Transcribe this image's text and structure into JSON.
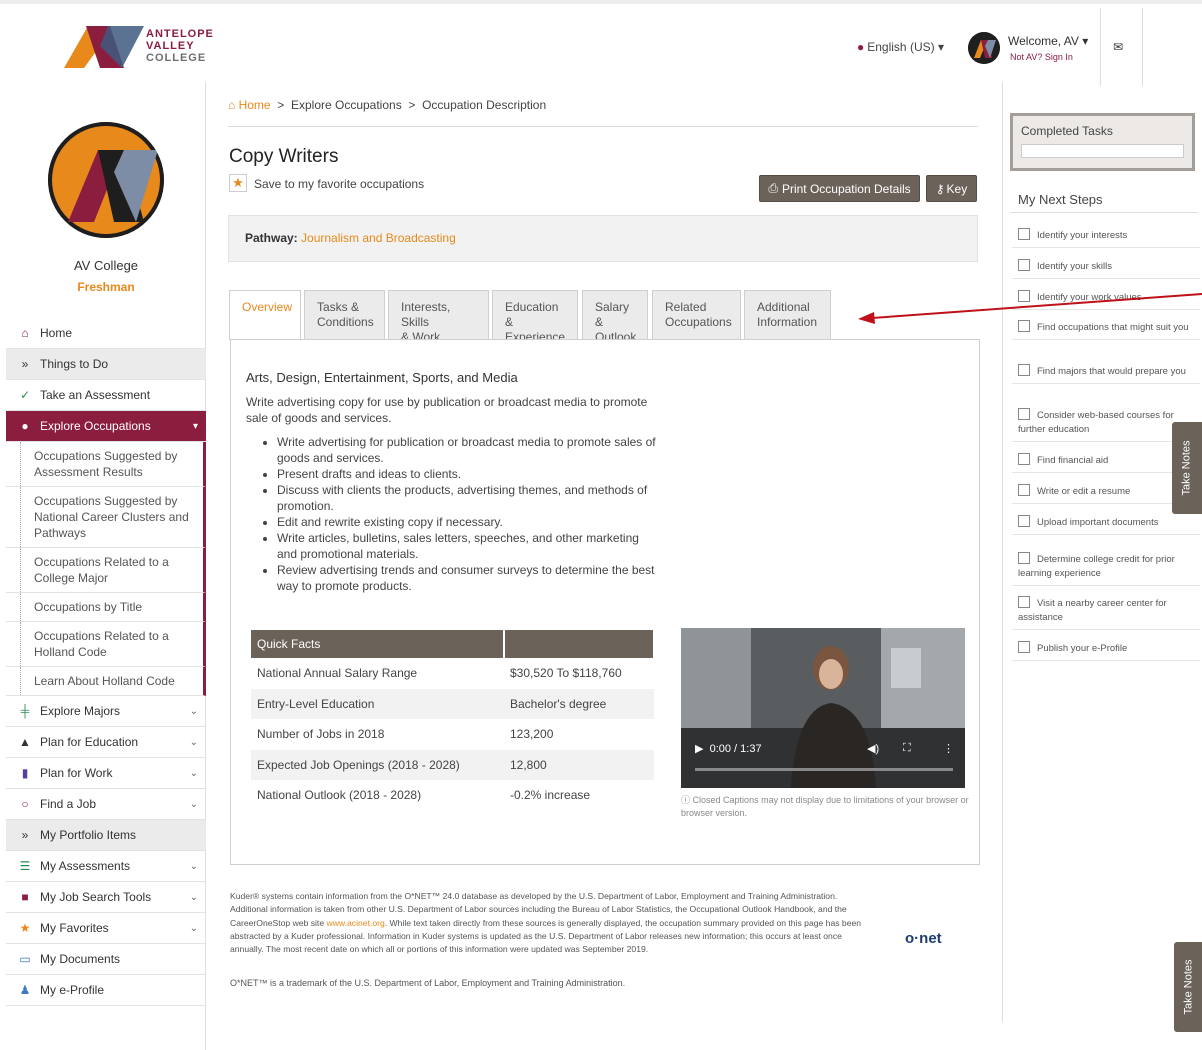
{
  "header": {
    "logo": {
      "line1": "ANTELOPE",
      "line2": "VALLEY",
      "line3": "COLLEGE"
    },
    "language": "English (US)",
    "welcome": "Welcome, AV",
    "not_user": "Not AV? Sign In"
  },
  "profile": {
    "name": "AV College",
    "year": "Freshman"
  },
  "nav": {
    "home": "Home",
    "things_to_do": "Things to Do",
    "take_assessment": "Take an Assessment",
    "explore_occupations": "Explore Occupations",
    "sub": [
      "Occupations Suggested by Assessment Results",
      "Occupations Suggested by National Career Clusters and Pathways",
      "Occupations Related to a College Major",
      "Occupations by Title",
      "Occupations Related to a Holland Code",
      "Learn About Holland Code"
    ],
    "explore_majors": "Explore Majors",
    "plan_education": "Plan for Education",
    "plan_work": "Plan for Work",
    "find_job": "Find a Job",
    "portfolio": "My Portfolio Items",
    "assessments": "My Assessments",
    "job_tools": "My Job Search Tools",
    "favorites": "My Favorites",
    "documents": "My Documents",
    "eprofile": "My e-Profile"
  },
  "breadcrumb": {
    "home": "Home",
    "sep": ">",
    "b2": "Explore Occupations",
    "b3": "Occupation Description"
  },
  "page": {
    "title": "Copy Writers",
    "save_fav": "Save to my favorite occupations",
    "print_btn": "Print Occupation Details",
    "key_btn": "Key",
    "pathway_label": "Pathway:",
    "pathway_value": "Journalism and Broadcasting"
  },
  "tabs": [
    {
      "l1": "Overview",
      "l2": ""
    },
    {
      "l1": "Tasks &",
      "l2": "Conditions"
    },
    {
      "l1": "Interests, Skills",
      "l2": "& Work Values"
    },
    {
      "l1": "Education &",
      "l2": "Experience"
    },
    {
      "l1": "Salary &",
      "l2": "Outlook"
    },
    {
      "l1": "Related",
      "l2": "Occupations"
    },
    {
      "l1": "Additional",
      "l2": "Information"
    }
  ],
  "overview": {
    "cluster": "Arts, Design, Entertainment, Sports, and Media",
    "description": "Write advertising copy for use by publication or broadcast media to promote sale of goods and services.",
    "tasks": [
      "Write advertising for publication or broadcast media to promote sales of goods and services.",
      "Present drafts and ideas to clients.",
      "Discuss with clients the products, advertising themes, and methods of promotion.",
      "Edit and rewrite existing copy if necessary.",
      "Write articles, bulletins, sales letters, speeches, and other marketing and promotional materials.",
      "Review advertising trends and consumer surveys to determine the best way to promote products."
    ]
  },
  "quick_facts": {
    "header": "Quick Facts",
    "rows": [
      {
        "label": "National Annual Salary Range",
        "value": "$30,520 To $118,760"
      },
      {
        "label": "Entry-Level Education",
        "value": "Bachelor's degree"
      },
      {
        "label": "Number of Jobs in 2018",
        "value": "123,200"
      },
      {
        "label": "Expected Job Openings (2018 - 2028)",
        "value": "12,800"
      },
      {
        "label": "National Outlook (2018 - 2028)",
        "value": "-0.2% increase"
      }
    ]
  },
  "video": {
    "time": "0:00 / 1:37",
    "note": "Closed Captions may not display due to limitations of your browser or browser version."
  },
  "footer": {
    "text1": "Kuder® systems contain information from the O*NET™ 24.0 database as developed by the U.S. Department of Labor, Employment and Training Administration. Additional information is taken from other U.S. Department of Labor sources including the Bureau of Labor Statistics, the Occupational Outlook Handbook, and the CareerOneStop web site",
    "link": "www.acinet.org",
    "text2": ". While text taken directly from these sources is generally displayed, the occupation summary provided on this page has been abstracted by a Kuder professional. Information in Kuder systems is updated as the U.S. Department of Labor releases new information; this occurs at least once annually. The most recent date on which all or portions of this information were updated was September 2019.",
    "trademark": "O*NET™ is a trademark of the U.S. Department of Labor, Employment and Training Administration.",
    "onet_logo": "o·net"
  },
  "right": {
    "completed": "Completed Tasks",
    "next_steps": "My Next Steps",
    "steps": [
      "Identify your interests",
      "Identify your skills",
      "Identify your work values",
      "Find occupations that might suit you",
      "Find majors that would prepare you",
      "Consider web-based courses for further education",
      "Find financial aid",
      "Write or edit a resume",
      "Upload important documents",
      "Determine college credit for prior learning experience",
      "Visit a nearby career center for assistance",
      "Publish your e-Profile"
    ],
    "take_notes": "Take Notes"
  },
  "colors": {
    "brand": "#8b1e3f",
    "accent": "#e8891b",
    "button": "#6b625a"
  }
}
